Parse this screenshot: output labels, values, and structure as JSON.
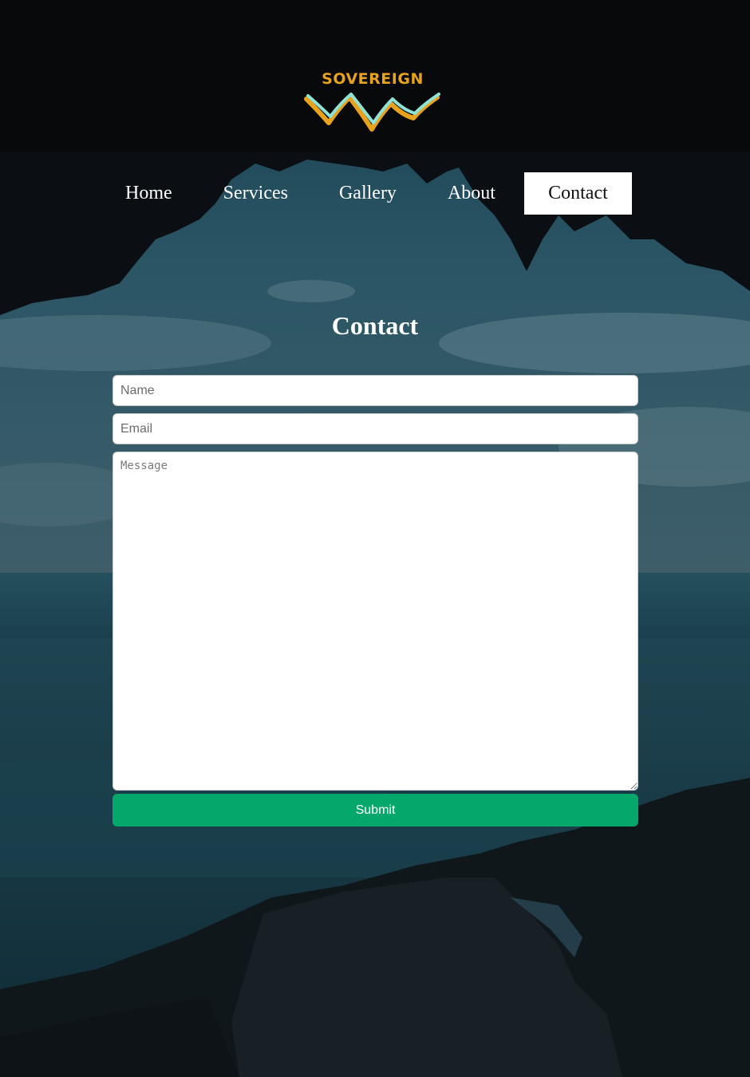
{
  "brand": {
    "logo_text": "SOVEREIGN",
    "logo_colors": {
      "gold": "#e8a21c",
      "aqua": "#8fe3d6"
    }
  },
  "nav": {
    "items": [
      {
        "label": "Home"
      },
      {
        "label": "Services"
      },
      {
        "label": "Gallery"
      },
      {
        "label": "About"
      },
      {
        "label": "Contact",
        "active": true
      }
    ]
  },
  "contact": {
    "title": "Contact",
    "form": {
      "name_placeholder": "Name",
      "email_placeholder": "Email",
      "message_placeholder": "Message",
      "submit_label": "Submit"
    }
  },
  "colors": {
    "submit_background": "#05a86a",
    "nav_active_background": "#ffffff",
    "sky_tint": "#1d4a5a"
  }
}
